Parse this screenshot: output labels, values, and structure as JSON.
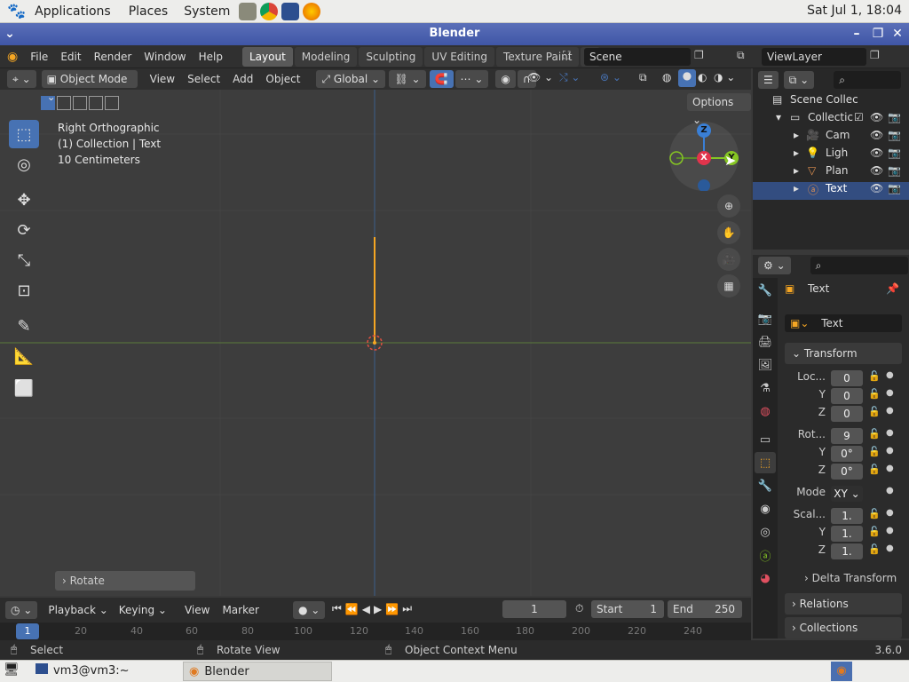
{
  "panel": {
    "applications": "Applications",
    "places": "Places",
    "system": "System",
    "clock": "Sat Jul 1, 18:04"
  },
  "window": {
    "title": "Blender"
  },
  "menubar": {
    "file": "File",
    "edit": "Edit",
    "render": "Render",
    "window": "Window",
    "help": "Help"
  },
  "workspaces": [
    "Layout",
    "Modeling",
    "Sculpting",
    "UV Editing",
    "Texture Paint",
    "Sh"
  ],
  "scene": {
    "label": "Scene",
    "viewlayer": "ViewLayer"
  },
  "viewport": {
    "mode": "Object Mode",
    "view": "View",
    "select": "Select",
    "add": "Add",
    "object": "Object",
    "orientation": "Global",
    "options": "Options",
    "info_view": "Right Orthographic",
    "info_collection": "(1) Collection | Text",
    "info_scale": "10 Centimeters",
    "last_op": "Rotate",
    "gizmo": {
      "z": "Z",
      "x": "X",
      "y": "Y"
    }
  },
  "outliner": {
    "root": "Scene Collec",
    "items": [
      {
        "label": "Collectic"
      },
      {
        "label": "Cam"
      },
      {
        "label": "Ligh"
      },
      {
        "label": "Plan"
      },
      {
        "label": "Text"
      }
    ]
  },
  "properties": {
    "object_name": "Text",
    "data_name": "Text",
    "transform": "Transform",
    "location": {
      "label": "Loc...",
      "x": "0",
      "y": "0",
      "z": "0"
    },
    "rotation": {
      "label": "Rot...",
      "x": "9",
      "y": "0°",
      "z": "0°"
    },
    "mode": {
      "label": "Mode",
      "value": "XY"
    },
    "scale": {
      "label": "Scal...",
      "x": "1.",
      "y": "1.",
      "z": "1."
    },
    "axis_y": "Y",
    "axis_z": "Z",
    "delta": "Delta Transform",
    "relations": "Relations",
    "collections": "Collections"
  },
  "timeline": {
    "playback": "Playback",
    "keying": "Keying",
    "view": "View",
    "marker": "Marker",
    "current_frame": "1",
    "start_label": "Start",
    "start": "1",
    "end_label": "End",
    "end": "250",
    "ticks": [
      "1",
      "20",
      "40",
      "60",
      "80",
      "100",
      "120",
      "140",
      "160",
      "180",
      "200",
      "220",
      "240"
    ]
  },
  "status": {
    "select": "Select",
    "rotate_view": "Rotate View",
    "context_menu": "Object Context Menu",
    "version": "3.6.0"
  },
  "taskbar": {
    "terminal": "vm3@vm3:~",
    "blender": "Blender"
  },
  "colors": {
    "accent": "#4772b3",
    "x_axis": "#e2344c",
    "y_axis": "#86c623",
    "z_axis": "#3a7fd5",
    "selected_row": "#334d80",
    "object_outline": "#f5a623"
  }
}
